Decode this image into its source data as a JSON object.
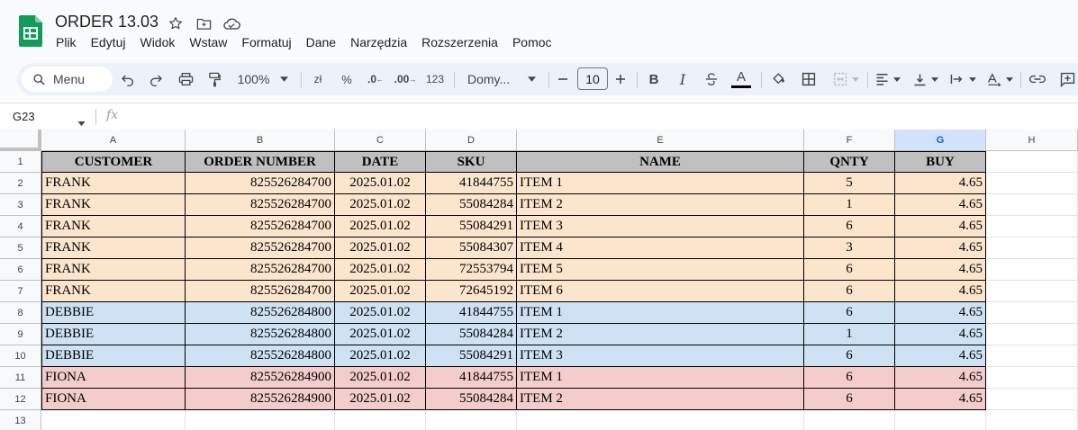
{
  "app": {
    "doc_title": "ORDER 13.03",
    "menu": [
      "Plik",
      "Edytuj",
      "Widok",
      "Wstaw",
      "Formatuj",
      "Dane",
      "Narzędzia",
      "Rozszerzenia",
      "Pomoc"
    ]
  },
  "toolbar": {
    "menu_search": "Menu",
    "zoom": "100%",
    "currency": "zł",
    "percent": "%",
    "dec_decrease": ".0",
    "dec_increase": ".00",
    "number_format": "123",
    "font": "Domy...",
    "font_size": "10",
    "bold": "B",
    "italic": "I",
    "text_color": "A"
  },
  "formula_bar": {
    "cell_ref": "G23",
    "fx": "fx"
  },
  "sheet": {
    "columns": [
      "A",
      "B",
      "C",
      "D",
      "E",
      "F",
      "G",
      "H"
    ],
    "selected_column": "G",
    "row_numbers": [
      "1",
      "2",
      "3",
      "4",
      "5",
      "6",
      "7",
      "8",
      "9",
      "10",
      "11",
      "12",
      "13"
    ],
    "header": [
      "CUSTOMER",
      "ORDER NUMBER",
      "DATE",
      "SKU",
      "NAME",
      "QNTY",
      "BUY"
    ],
    "rows": [
      [
        "FRANK",
        "825526284700",
        "2025.01.02",
        "41844755",
        "ITEM 1",
        "5",
        "4.65"
      ],
      [
        "FRANK",
        "825526284700",
        "2025.01.02",
        "55084284",
        "ITEM 2",
        "1",
        "4.65"
      ],
      [
        "FRANK",
        "825526284700",
        "2025.01.02",
        "55084291",
        "ITEM 3",
        "6",
        "4.65"
      ],
      [
        "FRANK",
        "825526284700",
        "2025.01.02",
        "55084307",
        "ITEM 4",
        "3",
        "4.65"
      ],
      [
        "FRANK",
        "825526284700",
        "2025.01.02",
        "72553794",
        "ITEM 5",
        "6",
        "4.65"
      ],
      [
        "FRANK",
        "825526284700",
        "2025.01.02",
        "72645192",
        "ITEM 6",
        "6",
        "4.65"
      ],
      [
        "DEBBIE",
        "825526284800",
        "2025.01.02",
        "41844755",
        "ITEM 1",
        "6",
        "4.65"
      ],
      [
        "DEBBIE",
        "825526284800",
        "2025.01.02",
        "55084284",
        "ITEM 2",
        "1",
        "4.65"
      ],
      [
        "DEBBIE",
        "825526284800",
        "2025.01.02",
        "55084291",
        "ITEM 3",
        "6",
        "4.65"
      ],
      [
        "FIONA",
        "825526284900",
        "2025.01.02",
        "41844755",
        "ITEM 1",
        "6",
        "4.65"
      ],
      [
        "FIONA",
        "825526284900",
        "2025.01.02",
        "55084284",
        "ITEM 2",
        "6",
        "4.65"
      ]
    ],
    "colors": {
      "header_fill": "#c0c0c0",
      "FRANK": "#fce5cd",
      "DEBBIE": "#cfe2f3",
      "FIONA": "#f4cccc"
    }
  }
}
